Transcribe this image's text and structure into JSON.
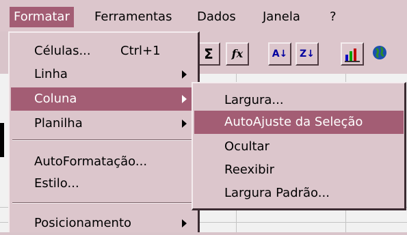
{
  "menubar": {
    "formatar": "Formatar",
    "ferramentas": "Ferramentas",
    "dados": "Dados",
    "janela": "Janela",
    "help": "?"
  },
  "toolbar": {
    "sigma": "Σ",
    "fx": "fx",
    "sort_asc": "A↓",
    "sort_desc": "Z↓"
  },
  "format_menu": {
    "celulas": "Células...",
    "celulas_shortcut": "Ctrl+1",
    "linha": "Linha",
    "coluna": "Coluna",
    "planilha": "Planilha",
    "autoformatacao": "AutoFormatação...",
    "estilo": "Estilo...",
    "posicionamento": "Posicionamento"
  },
  "coluna_submenu": {
    "largura": "Largura...",
    "autoajuste": "AutoAjuste da Seleção",
    "ocultar": "Ocultar",
    "reexibir": "Reexibir",
    "largura_padrao": "Largura Padrão..."
  },
  "colors": {
    "highlight": "#a35d74",
    "menu_bg": "#dcc6cc"
  }
}
